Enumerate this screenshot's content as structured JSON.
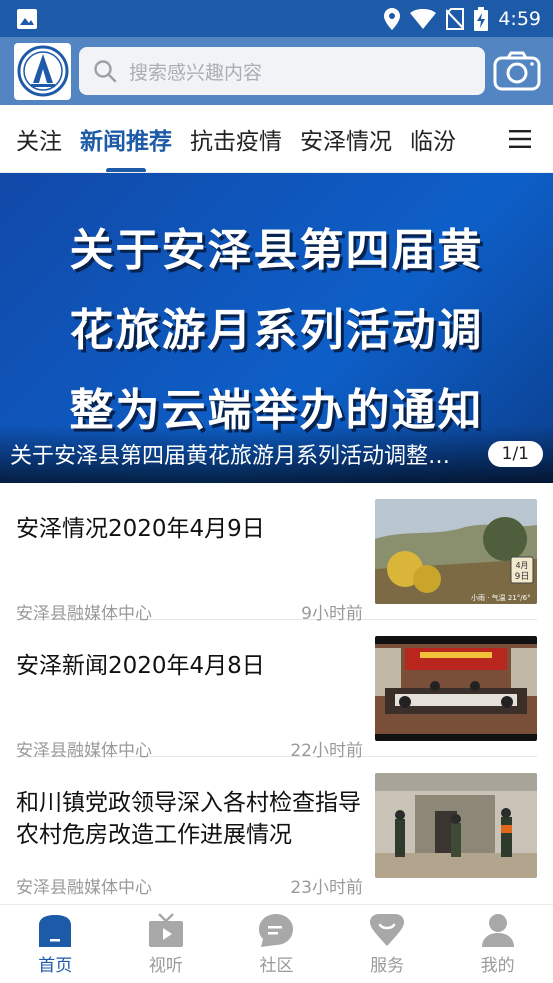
{
  "status_bar": {
    "time": "4:59"
  },
  "search": {
    "placeholder": "搜索感兴趣内容"
  },
  "tabs": [
    {
      "label": "关注"
    },
    {
      "label": "新闻推荐"
    },
    {
      "label": "抗击疫情"
    },
    {
      "label": "安泽情况"
    },
    {
      "label": "临汾"
    }
  ],
  "banner": {
    "lines": [
      "关于安泽县第四届黄",
      "花旅游月系列活动调",
      "整为云端举办的通知"
    ],
    "caption": "关于安泽县第四届黄花旅游月系列活动调整为云端举办的通知",
    "count": "1/1"
  },
  "news": [
    {
      "title": "安泽情况2020年4月9日",
      "source": "安泽县融媒体中心",
      "time": "9小时前",
      "thumb_badge": "4月9日",
      "thumb_text": "小雨 · 气温 21°/6°"
    },
    {
      "title": "安泽新闻2020年4月8日",
      "source": "安泽县融媒体中心",
      "time": "22小时前"
    },
    {
      "title": "和川镇党政领导深入各村检查指导农村危房改造工作进展情况",
      "source": "安泽县融媒体中心",
      "time": "23小时前"
    }
  ],
  "bottom_nav": [
    {
      "label": "首页",
      "icon": "home-icon"
    },
    {
      "label": "视听",
      "icon": "tv-icon"
    },
    {
      "label": "社区",
      "icon": "chat-icon"
    },
    {
      "label": "服务",
      "icon": "heart-icon"
    },
    {
      "label": "我的",
      "icon": "user-icon"
    }
  ],
  "colors": {
    "primary": "#1d5aa8",
    "header": "#5285c1",
    "banner": "#1149a8"
  }
}
